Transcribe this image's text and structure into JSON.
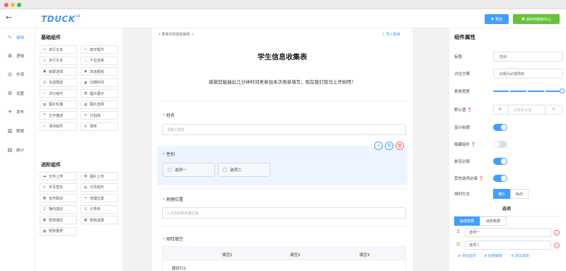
{
  "header": {
    "logo_text": "TDUCK",
    "logo_sup": "CE",
    "preview_label": "预览",
    "save_template_label": "保存到模板中心"
  },
  "nav": [
    {
      "icon": "edit-icon",
      "glyph": "✎",
      "label": "编辑",
      "active": true
    },
    {
      "icon": "logic-icon",
      "glyph": "⊞",
      "label": "逻辑",
      "active": false
    },
    {
      "icon": "appearance-icon",
      "glyph": "◎",
      "label": "外观",
      "active": false
    },
    {
      "icon": "settings-icon",
      "glyph": "⚙",
      "label": "设置",
      "active": false
    },
    {
      "icon": "publish-icon",
      "glyph": "✈",
      "label": "发布",
      "active": false
    },
    {
      "icon": "data-icon",
      "glyph": "▥",
      "label": "数据",
      "active": false
    },
    {
      "icon": "stats-icon",
      "glyph": "▤",
      "label": "统计",
      "active": false
    }
  ],
  "palette": {
    "basic_title": "基础组件",
    "basic": [
      {
        "icon": "single-line-text-icon",
        "glyph": "▭",
        "label": "单行文本"
      },
      {
        "icon": "number-icon",
        "glyph": "▭",
        "label": "数字框件"
      },
      {
        "icon": "multi-line-text-icon",
        "glyph": "▭",
        "label": "多行文本"
      },
      {
        "icon": "dropdown-icon",
        "glyph": "◌",
        "label": "下拉选择"
      },
      {
        "icon": "cascader-icon",
        "glyph": "▣",
        "label": "级联选择"
      },
      {
        "icon": "radio-icon",
        "glyph": "◉",
        "label": "单选框组"
      },
      {
        "icon": "checkbox-icon",
        "glyph": "☑",
        "label": "多选框组"
      },
      {
        "icon": "datetime-icon",
        "glyph": "▦",
        "label": "日期时间"
      },
      {
        "icon": "rating-icon",
        "glyph": "☆",
        "label": "评分组件"
      },
      {
        "icon": "image-display-icon",
        "glyph": "▨",
        "label": "图片展示"
      },
      {
        "icon": "image-carousel-icon",
        "glyph": "▨",
        "label": "图片轮播"
      },
      {
        "icon": "image-select-icon",
        "glyph": "▨",
        "label": "图片选择"
      },
      {
        "icon": "text-desc-icon",
        "glyph": "T",
        "label": "文字描述"
      },
      {
        "icon": "divider-icon",
        "glyph": "≡",
        "label": "分割线"
      },
      {
        "icon": "slider-icon",
        "glyph": "⇠",
        "label": "滑块组件"
      },
      {
        "icon": "sort-icon",
        "glyph": "⇅",
        "label": "排序"
      }
    ],
    "advanced_title": "进阶组件",
    "advanced": [
      {
        "icon": "file-upload-icon",
        "glyph": "☁",
        "label": "文件上传"
      },
      {
        "icon": "image-upload-icon",
        "glyph": "▨",
        "label": "图片上传"
      },
      {
        "icon": "signature-icon",
        "glyph": "✍",
        "label": "手写签名"
      },
      {
        "icon": "pagination-icon",
        "glyph": "▤",
        "label": "分页组件"
      },
      {
        "icon": "province-city-icon",
        "glyph": "▦",
        "label": "省市联动"
      },
      {
        "icon": "location-icon",
        "glyph": "⌖",
        "label": "地理位置"
      },
      {
        "icon": "fill-blank-icon",
        "glyph": "☷",
        "label": "横向填空"
      },
      {
        "icon": "sub-form-icon",
        "glyph": "☷",
        "label": "子表单"
      },
      {
        "icon": "matrix-fill-icon",
        "glyph": "▦",
        "label": "矩阵填空"
      },
      {
        "icon": "matrix-select-icon",
        "glyph": "▦",
        "label": "矩阵选择"
      },
      {
        "icon": "matrix-scale-icon",
        "glyph": "▦",
        "label": "矩阵量表"
      }
    ]
  },
  "canvas": {
    "autosave": "• 表单内容自动保存 ✓",
    "import": "⇩ 导入题目",
    "form_title": "学生信息收集表",
    "form_desc": "感谢您能抽出几分钟时间来参加本次表单填写，现在我们就马上开始吧！",
    "fields": {
      "name_label": "姓名",
      "name_placeholder": "请输入姓名",
      "gender_label": "性别",
      "gender_options": [
        "选项一",
        "选项二"
      ],
      "location_label": "地理位置",
      "location_placeholder": "⌖ 点击获取地理位置",
      "matrix_label": "矩阵填空",
      "matrix_cols": [
        "填空1",
        "填空2",
        "填空3"
      ],
      "matrix_row": "题目行1"
    }
  },
  "props": {
    "title": "组件属性",
    "label_title": "标题",
    "title_value": "性别",
    "label_placeholder": "占位文案",
    "placeholder_value": "此题为必填项目",
    "label_width": "表单宽度",
    "label_default": "默认值 ❓",
    "default_placeholder": "设置默认值",
    "label_show_title": "显示标题",
    "show_title_on": true,
    "label_hidden": "隐藏组件 ❓",
    "hidden_on": false,
    "label_required": "是否必填",
    "required_on": true,
    "label_other_required": "其他选项必填 ❓",
    "other_required_on": true,
    "label_layout": "排列方式",
    "layout_options": [
      "横向",
      "纵向"
    ],
    "options_title": "选项",
    "data_tabs": [
      "静态数据",
      "动态数据"
    ],
    "options": [
      "选项一",
      "选项二"
    ],
    "links": [
      "⊕ 添加选项",
      "⊕ 批量编辑",
      "⊕ 添加其他"
    ]
  },
  "colors": {
    "primary": "#409eff",
    "success": "#67c23a",
    "danger": "#f56c6c"
  }
}
